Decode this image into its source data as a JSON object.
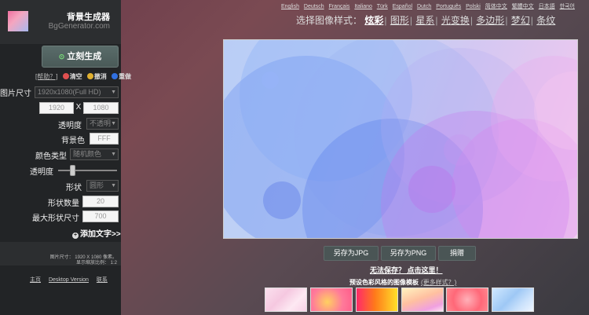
{
  "brand": {
    "title": "背景生成器",
    "subtitle": "BgGenerator.com"
  },
  "sidebar": {
    "generate_label": "立刻生成",
    "help_label": "[帮助？]",
    "actions": [
      {
        "label": "清空",
        "color": "#e05050"
      },
      {
        "label": "撤消",
        "color": "#e0b030"
      },
      {
        "label": "重做",
        "color": "#3070e0"
      }
    ],
    "image_size_label": "图片尺寸",
    "image_size_value": "1920x1080(Full HD)",
    "width_value": "1920",
    "height_value": "1080",
    "by_label": "X",
    "opacity_label": "透明度",
    "opacity_value": "不透明",
    "bgcolor_label": "背景色",
    "bgcolor_value": "FFF",
    "colortype_label": "颜色类型",
    "colortype_value": "随机颜色",
    "transparency_label": "透明度",
    "transparency_level": 0.22,
    "shape_label": "形状",
    "shape_value": "圆形",
    "shape_count_label": "形状数量",
    "shape_count_value": "20",
    "max_size_label": "最大形状尺寸",
    "max_size_value": "700",
    "add_text_label": "添加文字>>",
    "info_line1": "图片尺寸：   1920 X 1080 像素。",
    "info_line2": "显示缩放比例：  1:2",
    "footer_links": [
      "主页",
      "Desktop Version",
      "联系"
    ]
  },
  "languages": [
    "English",
    "Deutsch",
    "Français",
    "Italiano",
    "Türk",
    "Español",
    "Dutch",
    "Português",
    "Polski",
    "简体中文",
    "繁體中文",
    "日本語",
    "한국어"
  ],
  "styles": {
    "prefix": "选择图像样式：",
    "options": [
      "炫彩",
      "图形",
      "星系",
      "光变换",
      "多边形",
      "梦幻",
      "条纹"
    ],
    "active_index": 0
  },
  "output": {
    "jpg_label": "另存为JPG",
    "png_label": "另存为PNG",
    "donate_label": "捐赠",
    "save_help": "无法保存？ 点击这里！"
  },
  "presets": {
    "title": "预设色彩风格的图像模板",
    "more": "(更多样式？)"
  },
  "colors": {
    "sidebar_bg": "#222426",
    "button_bg": "#4a5555",
    "active_style": "#ffffff"
  }
}
